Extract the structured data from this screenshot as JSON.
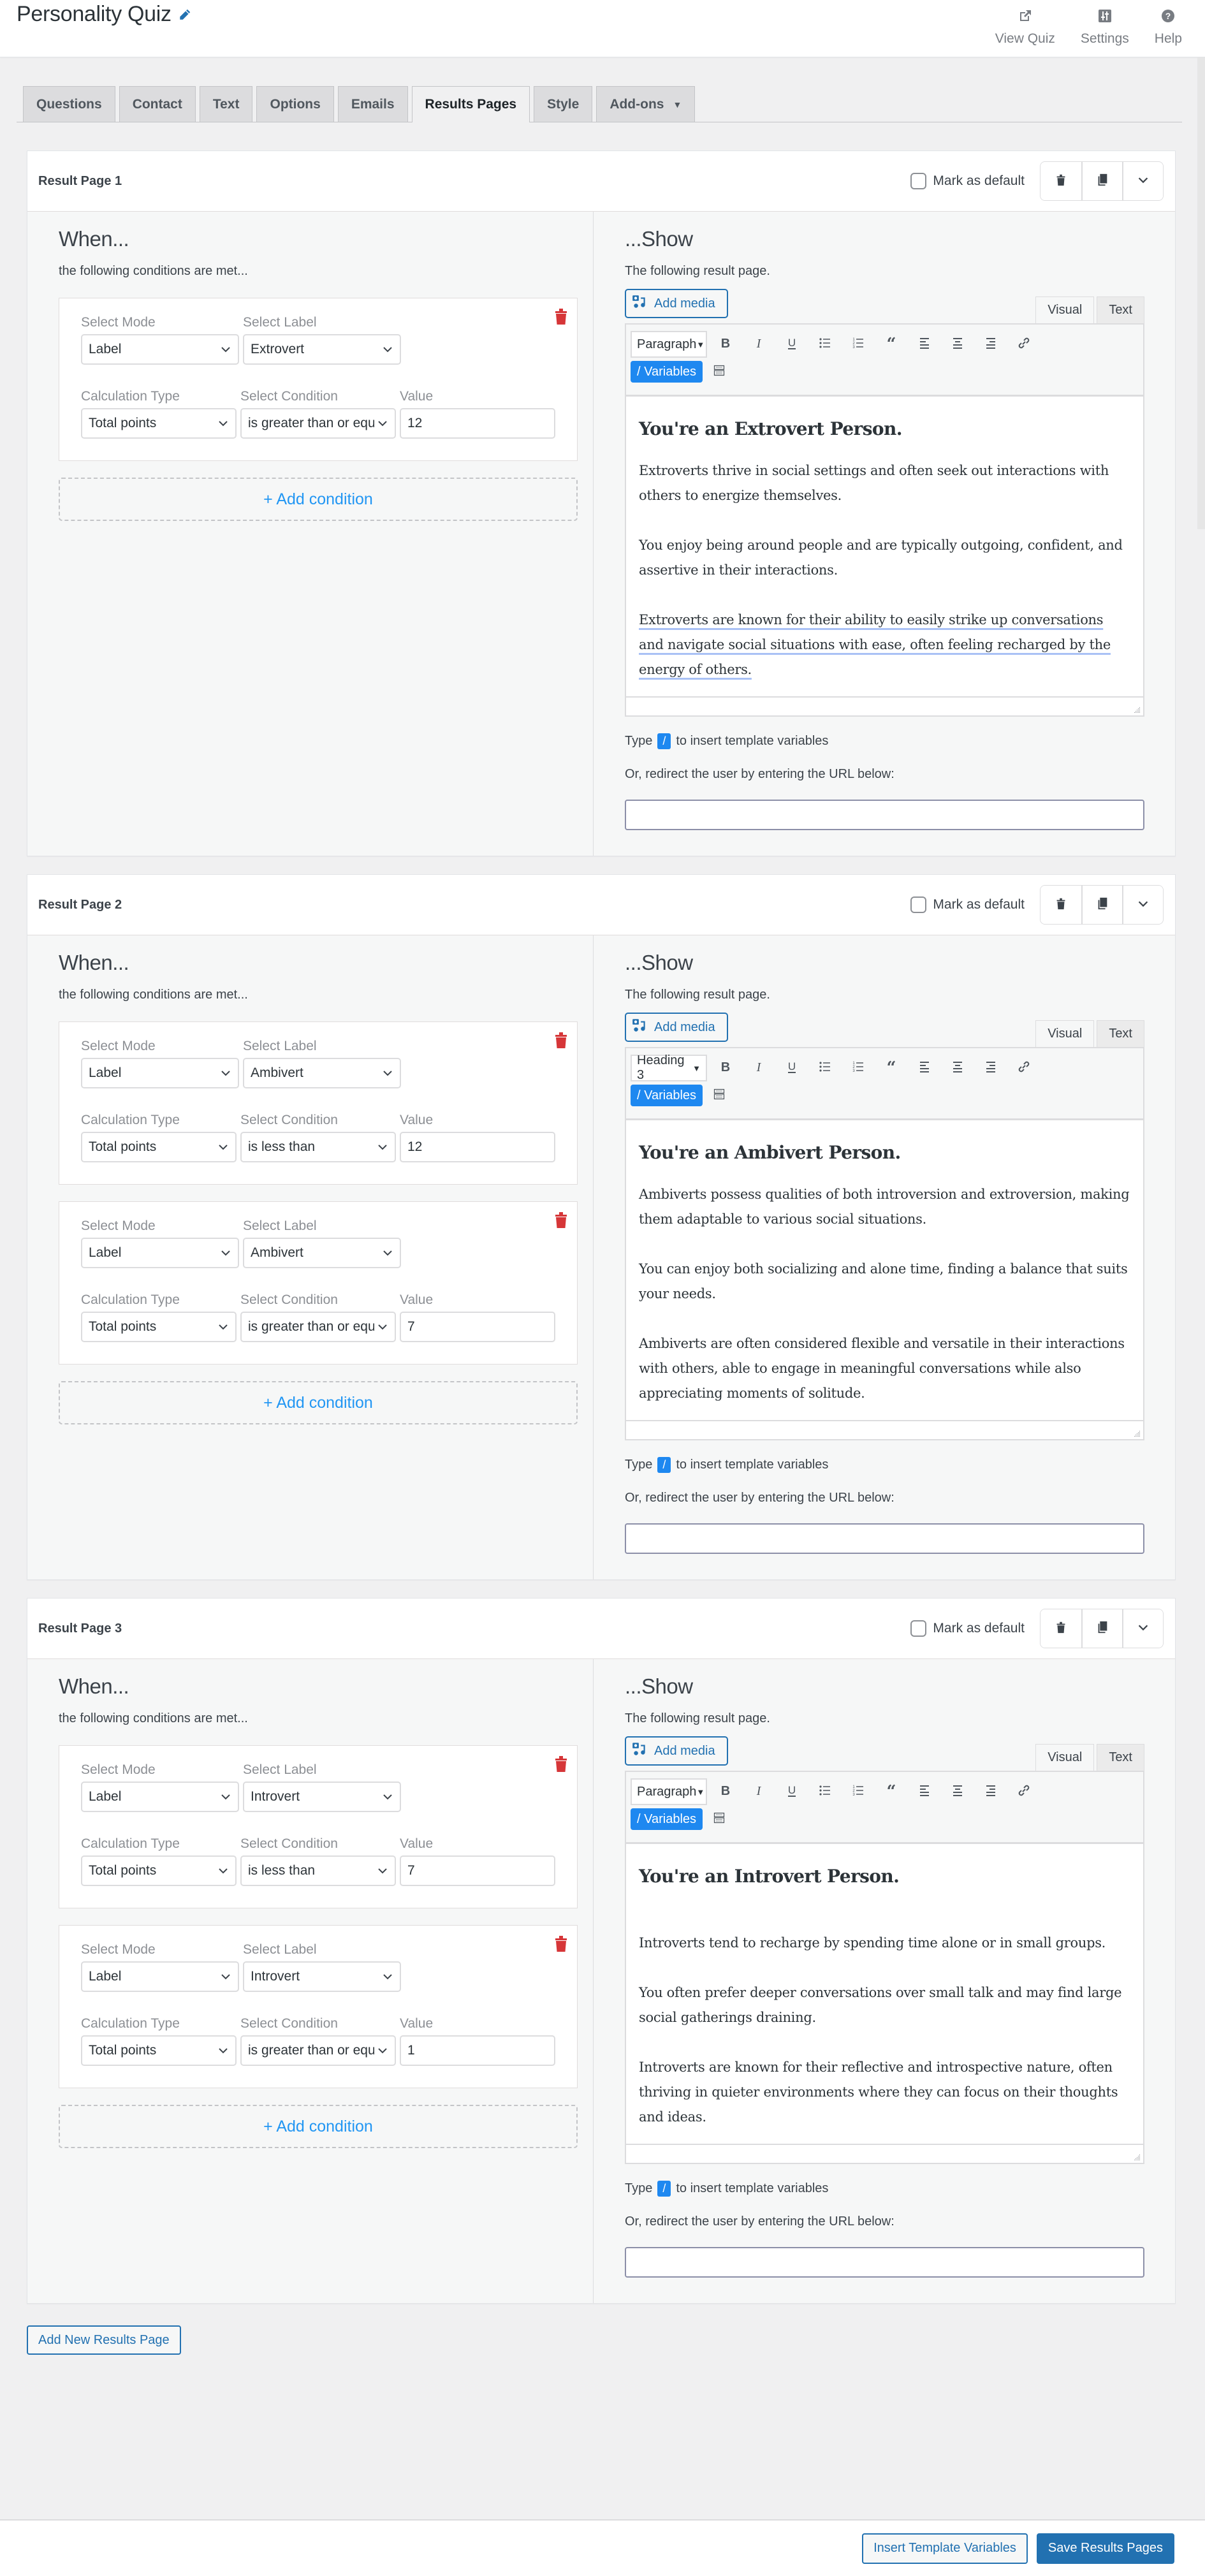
{
  "header": {
    "title": "Personality Quiz",
    "actions": [
      {
        "label": "View Quiz",
        "icon": "external-link-icon"
      },
      {
        "label": "Settings",
        "icon": "sliders-icon"
      },
      {
        "label": "Help",
        "icon": "help-icon"
      }
    ]
  },
  "tabs": [
    {
      "label": "Questions",
      "active": false
    },
    {
      "label": "Contact",
      "active": false
    },
    {
      "label": "Text",
      "active": false
    },
    {
      "label": "Options",
      "active": false
    },
    {
      "label": "Emails",
      "active": false
    },
    {
      "label": "Results Pages",
      "active": true
    },
    {
      "label": "Style",
      "active": false
    },
    {
      "label": "Add-ons",
      "active": false,
      "has_caret": true
    }
  ],
  "labels": {
    "mark_default": "Mark as default",
    "when_title": "When...",
    "when_sub": "the following conditions are met...",
    "show_title": "...Show",
    "show_sub": "The following result page.",
    "add_media": "Add media",
    "visual_tab": "Visual",
    "text_tab": "Text",
    "variables_btn": "/ Variables",
    "select_mode": "Select Mode",
    "select_label": "Select Label",
    "calc_type": "Calculation Type",
    "select_condition": "Select Condition",
    "value": "Value",
    "add_condition": "+ Add condition",
    "hint_type": "Type",
    "hint_key": "/",
    "hint_rest": "to insert template variables",
    "redirect": "Or, redirect the user by entering the URL below:"
  },
  "result_pages": [
    {
      "title": "Result Page 1",
      "default": false,
      "conditions": [
        {
          "mode": "Label",
          "label": "Extrovert",
          "calc": "Total points",
          "condition": "is greater than or equal to",
          "value": "12"
        }
      ],
      "show_add_condition": true,
      "format": "Paragraph",
      "heading": "You're an Extrovert Person.",
      "paragraphs": [
        "Extroverts thrive in social settings and often seek out interactions with others to energize themselves.",
        "You enjoy being around people and are typically outgoing, confident, and assertive in their interactions.",
        "Extroverts are known for their ability to easily strike up conversations and navigate social situations with ease, often feeling recharged by the energy of others."
      ],
      "underlined_paragraph": 2,
      "redirect_url": ""
    },
    {
      "title": "Result Page 2",
      "default": false,
      "conditions": [
        {
          "mode": "Label",
          "label": "Ambivert",
          "calc": "Total points",
          "condition": "is less than",
          "value": "12"
        },
        {
          "mode": "Label",
          "label": "Ambivert",
          "calc": "Total points",
          "condition": "is greater than or equal to",
          "value": "7"
        }
      ],
      "show_add_condition": true,
      "format": "Heading 3",
      "heading": "You're an Ambivert Person.",
      "paragraphs": [
        "Ambiverts possess qualities of both introversion and extroversion, making them adaptable to various social situations.",
        "You can enjoy both socializing and alone time, finding a balance that suits your needs.",
        "Ambiverts are often considered flexible and versatile in their interactions with others, able to engage in meaningful conversations while also appreciating moments of solitude."
      ],
      "underlined_paragraph": -1,
      "redirect_url": ""
    },
    {
      "title": "Result Page 3",
      "default": false,
      "conditions": [
        {
          "mode": "Label",
          "label": "Introvert",
          "calc": "Total points",
          "condition": "is less than",
          "value": "7"
        },
        {
          "mode": "Label",
          "label": "Introvert",
          "calc": "Total points",
          "condition": "is greater than or equal to",
          "value": "1"
        }
      ],
      "show_add_condition": true,
      "format": "Paragraph",
      "heading": "You're an Introvert Person.",
      "blank_after_heading": true,
      "paragraphs": [
        "Introverts tend to recharge by spending time alone or in small groups.",
        "You often prefer deeper conversations over small talk and may find large social gatherings draining.",
        "Introverts are known for their reflective and introspective nature, often thriving in quieter environments where they can focus on their thoughts and ideas."
      ],
      "underlined_paragraph": -1,
      "redirect_url": ""
    }
  ],
  "add_page_label": "Add New Results Page",
  "footer": {
    "insert_vars": "Insert Template Variables",
    "save": "Save Results Pages"
  },
  "colors": {
    "accent": "#2271b1",
    "variables_blue": "#1e88f0",
    "delete_red": "#d63638",
    "add_condition_blue": "#2196f3"
  }
}
